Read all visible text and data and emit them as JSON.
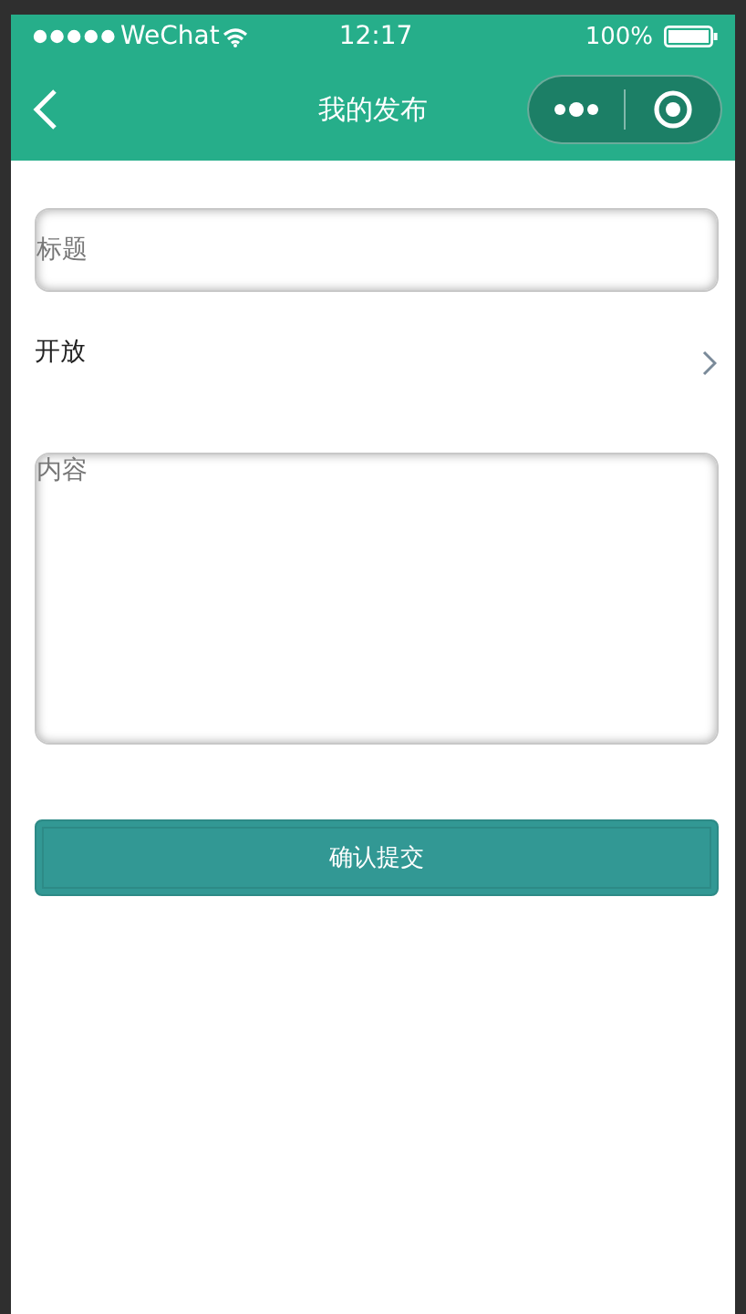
{
  "status_bar": {
    "carrier": "WeChat",
    "time": "12:17",
    "battery": "100%"
  },
  "nav_bar": {
    "title": "我的发布"
  },
  "form": {
    "title_field": {
      "placeholder": "标题"
    },
    "visibility": {
      "label": "开放"
    },
    "content_field": {
      "placeholder": "内容"
    },
    "submit_button": "确认提交"
  }
}
